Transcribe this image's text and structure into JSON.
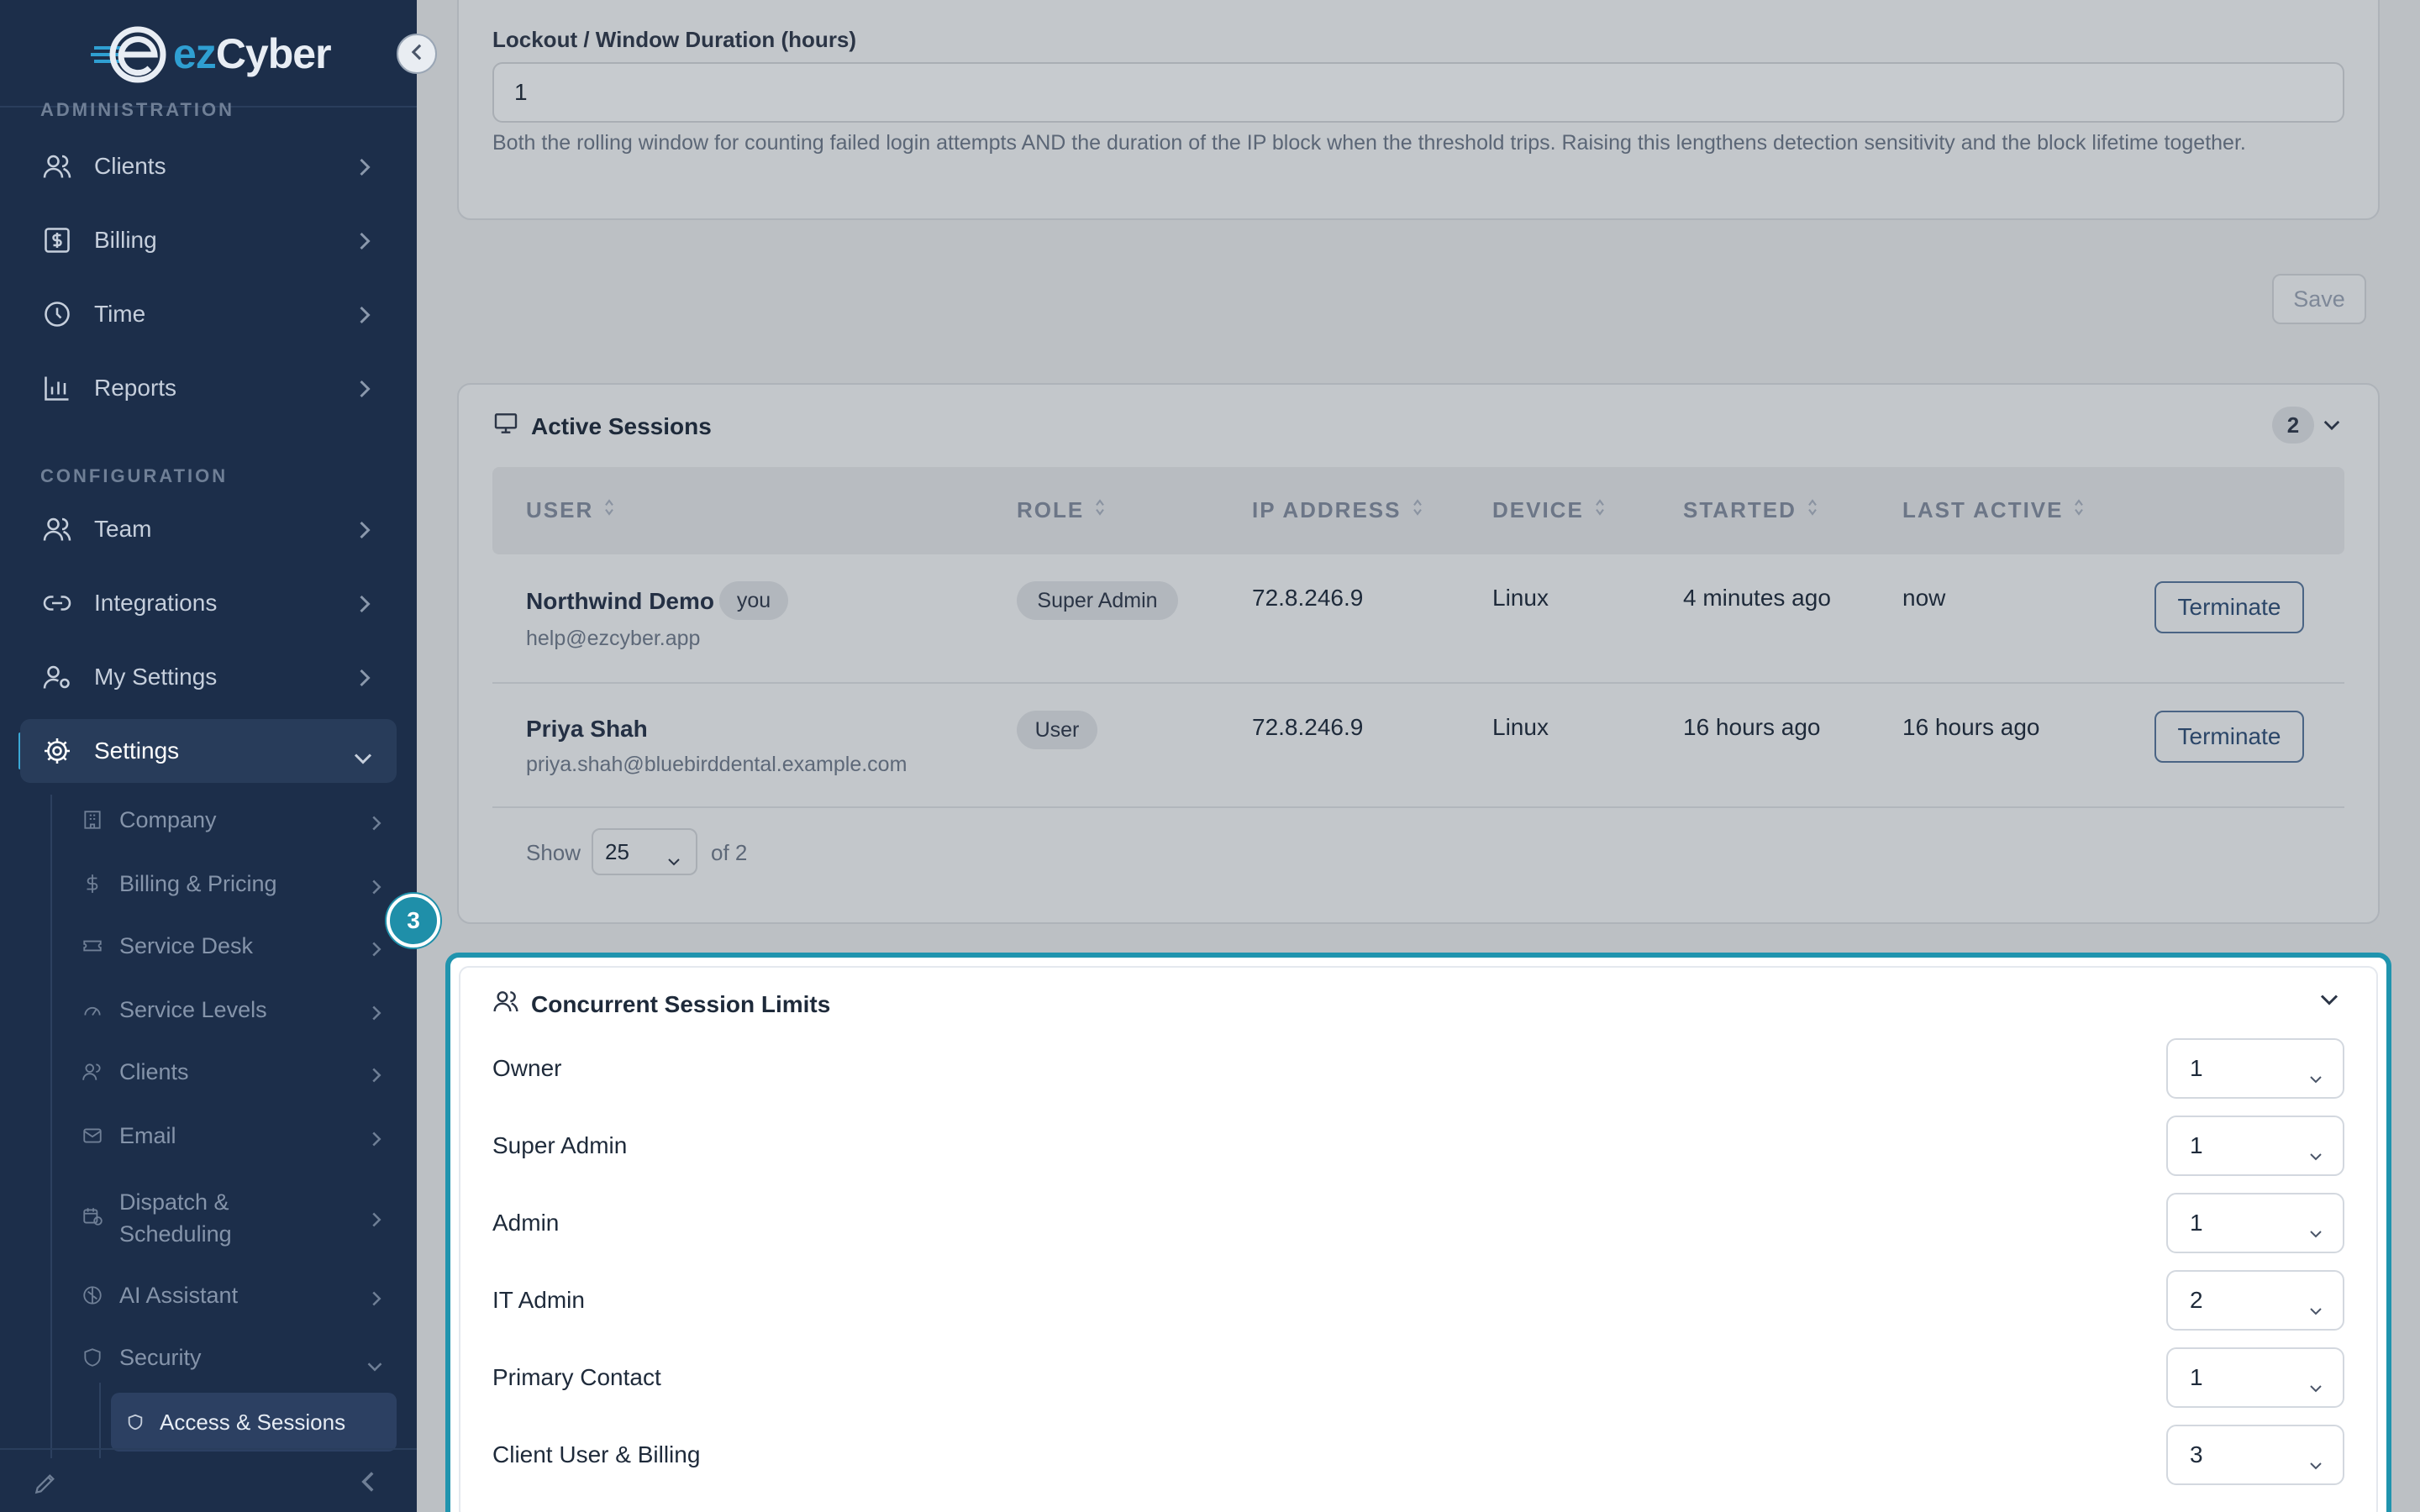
{
  "brand": {
    "logo_text_a": "ez",
    "logo_text_b": "Cyber"
  },
  "sidebar": {
    "section_admin": "ADMINISTRATION",
    "section_config": "CONFIGURATION",
    "items": [
      {
        "label": "Clients",
        "icon": "users-icon"
      },
      {
        "label": "Billing",
        "icon": "dollar-receipt-icon"
      },
      {
        "label": "Time",
        "icon": "clock-icon"
      },
      {
        "label": "Reports",
        "icon": "bar-chart-icon"
      },
      {
        "label": "Team",
        "icon": "users-icon"
      },
      {
        "label": "Integrations",
        "icon": "link-icon"
      },
      {
        "label": "My Settings",
        "icon": "user-gear-icon"
      },
      {
        "label": "Settings",
        "icon": "gear-icon"
      }
    ],
    "sub_items": [
      {
        "label": "Company",
        "icon": "building-icon"
      },
      {
        "label": "Billing & Pricing",
        "icon": "dollar-icon"
      },
      {
        "label": "Service Desk",
        "icon": "ticket-icon"
      },
      {
        "label": "Service Levels",
        "icon": "gauge-icon"
      },
      {
        "label": "Clients",
        "icon": "users-icon"
      },
      {
        "label": "Email",
        "icon": "mail-icon"
      },
      {
        "label": "Dispatch &",
        "label2": "Scheduling",
        "icon": "calendar-clock-icon"
      },
      {
        "label": "AI Assistant",
        "icon": "brain-icon"
      },
      {
        "label": "Security",
        "icon": "shield-icon"
      }
    ],
    "active_subsub": {
      "label": "Access & Sessions",
      "icon": "shield-icon"
    }
  },
  "lockout": {
    "label": "Lockout / Window Duration (hours)",
    "value": "1",
    "help": "Both the rolling window for counting failed login attempts AND the duration of the IP block when the threshold trips. Raising this lengthens detection sensitivity and the block lifetime together.",
    "save_label": "Save"
  },
  "active_sessions": {
    "title": "Active Sessions",
    "count": "2",
    "columns": [
      "USER",
      "ROLE",
      "IP ADDRESS",
      "DEVICE",
      "STARTED",
      "LAST ACTIVE"
    ],
    "rows": [
      {
        "name": "Northwind Demo",
        "you": "you",
        "email": "help@ezcyber.app",
        "role": "Super Admin",
        "ip": "72.8.246.9",
        "device": "Linux",
        "started": "4 minutes ago",
        "last_active": "now",
        "action": "Terminate"
      },
      {
        "name": "Priya Shah",
        "email": "priya.shah@bluebirddental.example.com",
        "role": "User",
        "ip": "72.8.246.9",
        "device": "Linux",
        "started": "16 hours ago",
        "last_active": "16 hours ago",
        "action": "Terminate"
      }
    ],
    "pagination": {
      "show_label": "Show",
      "page_size": "25",
      "of_label": "of 2"
    }
  },
  "concurrent_limits": {
    "step": "3",
    "title": "Concurrent Session Limits",
    "limits": [
      {
        "role": "Owner",
        "value": "1"
      },
      {
        "role": "Super Admin",
        "value": "1"
      },
      {
        "role": "Admin",
        "value": "1"
      },
      {
        "role": "IT Admin",
        "value": "2"
      },
      {
        "role": "Primary Contact",
        "value": "1"
      },
      {
        "role": "Client User & Billing",
        "value": "3"
      }
    ]
  },
  "colors": {
    "sidebar_bg": "#1c2e4a",
    "accent": "#2094ae",
    "brand_blue": "#2f9fd2"
  }
}
